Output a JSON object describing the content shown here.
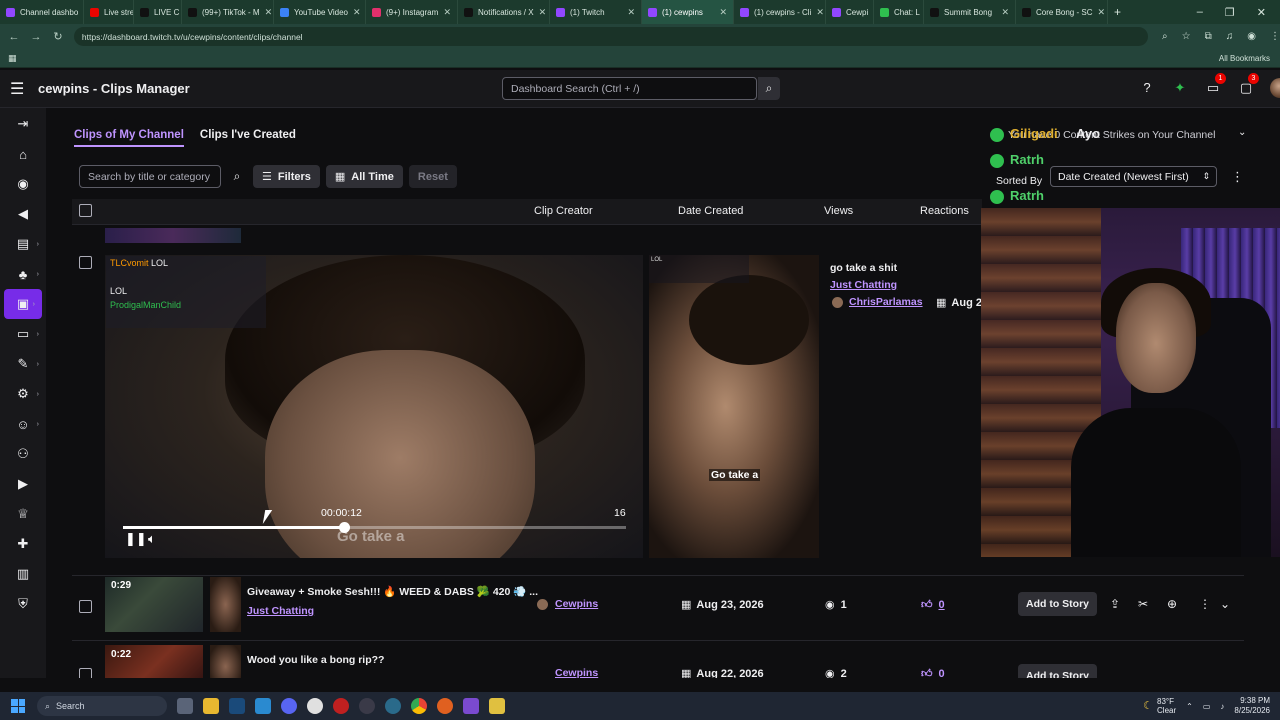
{
  "browser": {
    "tabs": [
      {
        "title": "Channel dashbo",
        "color": "#9147ff"
      },
      {
        "title": "Live stre",
        "color": "#eb0400"
      },
      {
        "title": "LIVE C",
        "color": "#111111"
      },
      {
        "title": "(99+) TikTok - M",
        "color": "#111111"
      },
      {
        "title": "YouTube Video",
        "color": "#3b82f6"
      },
      {
        "title": "(9+) Instagram",
        "color": "#e1306c"
      },
      {
        "title": "Notifications / X",
        "color": "#111111"
      },
      {
        "title": "(1) Twitch",
        "color": "#9147ff"
      },
      {
        "title": "(1) cewpins",
        "color": "#9147ff"
      },
      {
        "title": "(1) cewpins - Cli",
        "color": "#9147ff"
      },
      {
        "title": "Cewpi",
        "color": "#9147ff"
      },
      {
        "title": "Chat: L",
        "color": "#2fbf4f"
      },
      {
        "title": "Summit Bong",
        "color": "#111111"
      },
      {
        "title": "Core Bong - SC",
        "color": "#111111"
      }
    ],
    "active_tab_index": 8,
    "url": "https://dashboard.twitch.tv/u/cewpins/content/clips/channel",
    "bookmarks_label": "All Bookmarks"
  },
  "header": {
    "title": "cewpins - Clips Manager",
    "search_placeholder": "Dashboard Search (Ctrl + /)",
    "badge_inbox": "1",
    "badge_notifications": "3"
  },
  "subtabs": {
    "clips_of_channel": "Clips of My Channel",
    "clips_created": "Clips I've Created"
  },
  "toolbar": {
    "search_placeholder": "Search by title or category",
    "filters": "Filters",
    "all_time": "All Time",
    "reset": "Reset"
  },
  "table": {
    "headers": {
      "clip_creator": "Clip Creator",
      "date_created": "Date Created",
      "views": "Views",
      "reactions": "Reactions"
    }
  },
  "player": {
    "chat": [
      {
        "name": "TLCvomit",
        "msg": "LOL"
      },
      {
        "name": "",
        "msg": ""
      },
      {
        "name": "",
        "msg": "LOL"
      },
      {
        "name": "ProdigalManChild",
        "msg": ""
      }
    ],
    "current_time": "00:00:12",
    "end_time": "16",
    "progress": 0.44,
    "subtitle": "Go take a",
    "thumb_subtitle": "Go take a",
    "thumb_chat_msg": "LOL"
  },
  "expanded_clip": {
    "title": "go take a shit",
    "category": "Just Chatting",
    "creator": "ChrisParlamas",
    "date": "Aug 2"
  },
  "cam_overlay": {
    "line1_name": "Giligadi",
    "line1_msg": "Ayo",
    "line1_bg": "You have 0 Content Strikes on Your Channel",
    "line2_name": "Ratrh",
    "line3_name": "Ratrh",
    "sorted_by_label": "Sorted By",
    "sort_value": "Date Created (Newest First)"
  },
  "rows": [
    {
      "duration": "0:29",
      "title": "Giveaway + Smoke Sesh!!! 🔥 WEED & DABS 🥦 420 💨 ...",
      "category": "Just Chatting",
      "creator": "Cewpins",
      "date": "Aug 23, 2026",
      "views": "1",
      "reactions": "0",
      "add_story": "Add to Story"
    },
    {
      "duration": "0:22",
      "title": "Wood you like a bong rip??",
      "category": "",
      "creator": "Cewpins",
      "date": "Aug 22, 2026",
      "views": "2",
      "reactions": "0",
      "add_story": "Add to Story"
    }
  ],
  "taskbar": {
    "search": "Search",
    "weather_temp": "83°F",
    "weather_cond": "Clear",
    "time": "9:38 PM",
    "date": "8/25/2026"
  },
  "colors": {
    "accent": "#bf94ff",
    "active_nav": "#772ce8",
    "browser_chrome": "#1c3a2d"
  }
}
